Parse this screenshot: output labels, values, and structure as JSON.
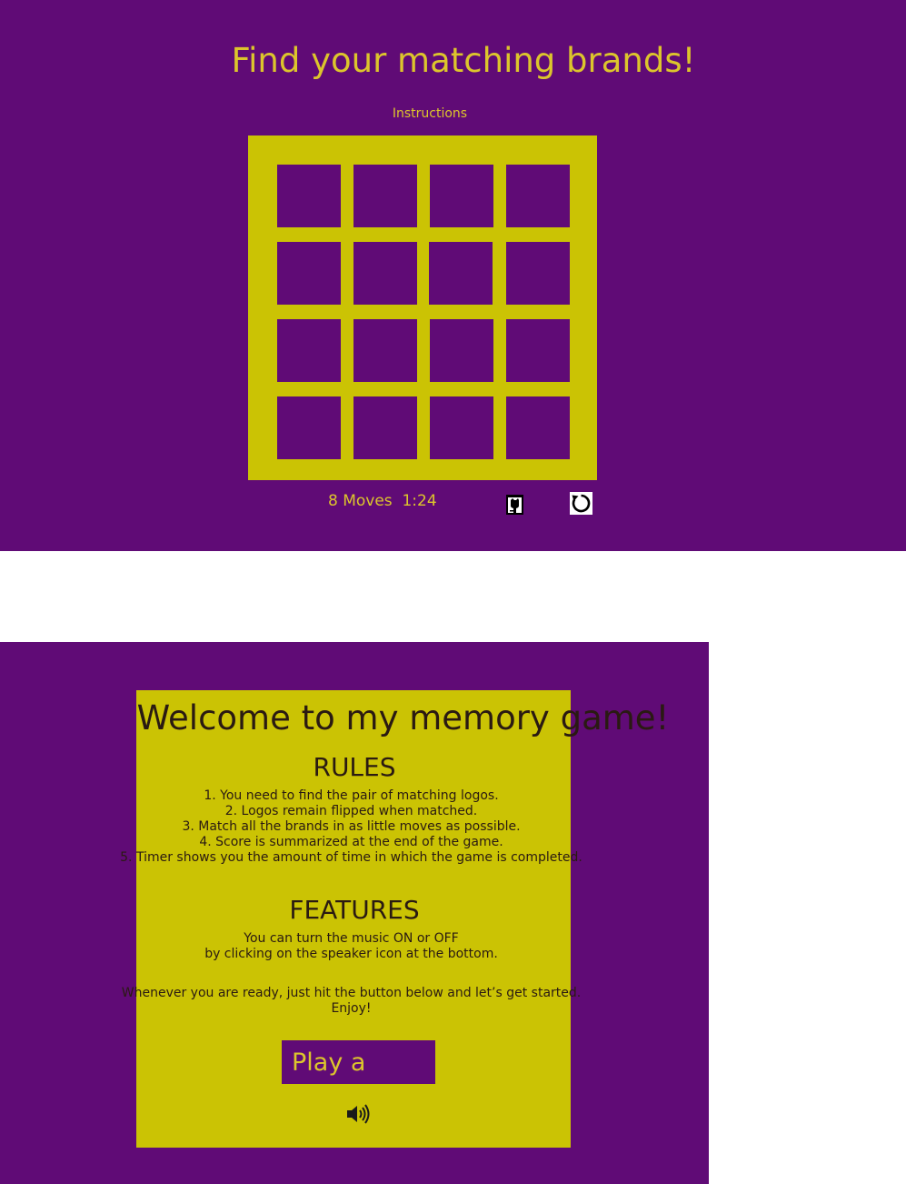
{
  "header": {
    "title": "Find your matching brands!",
    "instructions_link": "Instructions"
  },
  "board": {
    "rows": 4,
    "cols": 4,
    "cards_face_down": 16
  },
  "status": {
    "moves": "8 Moves",
    "timer": "1:24"
  },
  "icons": {
    "github": "github-icon",
    "restart": "restart-icon",
    "speaker": "speaker-icon"
  },
  "modal": {
    "welcome": "Welcome to my memory game!",
    "rules_heading": "RULES",
    "rules": [
      "1. You need to find the pair of matching logos.",
      "2. Logos remain flipped when matched.",
      "3. Match all the brands in as little moves as possible.",
      "4. Score is summarized at the end of the game.",
      "5. Timer shows you the amount of time in which the game is completed."
    ],
    "features_heading": "FEATURES",
    "features": [
      "You can turn the music ON or OFF",
      "by clicking on the speaker icon at the bottom."
    ],
    "ready": [
      "Whenever you are ready, just hit the button below and let’s get started.",
      "Enjoy!"
    ],
    "play_button": "Play a"
  },
  "colors": {
    "purple": "#600b76",
    "yellow": "#cbc304",
    "gold_text": "#dcc52c",
    "dark_text": "#2a1a12"
  }
}
